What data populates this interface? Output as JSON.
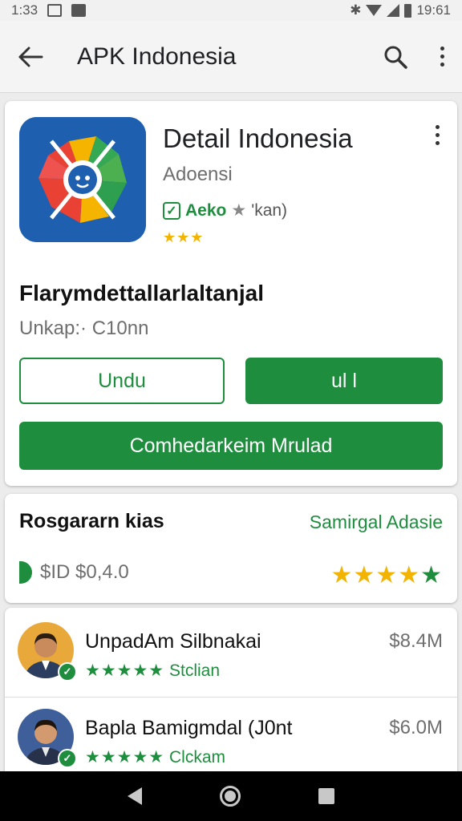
{
  "status_bar": {
    "time": "1:33",
    "clock": "19:61",
    "icons": [
      "image-icon",
      "photo-icon",
      "bluetooth-icon",
      "wifi-icon",
      "signal-icon",
      "battery-icon"
    ]
  },
  "app_bar": {
    "title": "APK Indonesia",
    "icons": [
      "back-arrow-icon",
      "search-icon",
      "more-vert-icon"
    ]
  },
  "app_card": {
    "name": "Detail Indonesia",
    "developer": "Adoensi",
    "verified_label": "Aeko",
    "verified_note": "'kan)",
    "small_stars": "★★★",
    "headline": "Flarymdettallarlaltanjal",
    "subline": "Unkap:· C10nn",
    "button_outline": "Undu",
    "button_solid": "ul l",
    "button_wide": "Comhedarkeim Mrulad"
  },
  "rating_card": {
    "title": "Rosgararn kias",
    "link": "Samirgal Adasie",
    "price": "$ID  $0,4.0",
    "stars": {
      "filled": "★★★★",
      "accent": "★"
    }
  },
  "list": {
    "items": [
      {
        "name": "UnpadAm Silbnakai",
        "stars": "★★★★★",
        "label": "Stclian",
        "price": "$8.4M"
      },
      {
        "name": "Bapla Bamigmdal (J0nt",
        "stars": "★★★★★",
        "label": "Clckam",
        "price": "$6.0M"
      }
    ]
  },
  "colors": {
    "accent_green": "#1e8e3e",
    "star_yellow": "#f2b400",
    "app_icon_bg": "#1f5fb0"
  }
}
